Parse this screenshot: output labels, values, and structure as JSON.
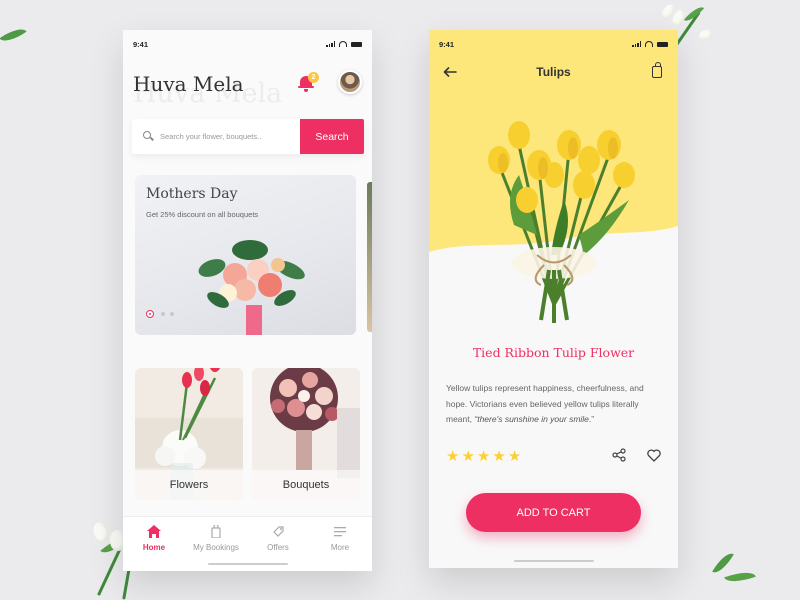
{
  "colors": {
    "accent": "#ee2f63",
    "yellow": "#fde67a",
    "star": "#fbd033",
    "badge": "#ffc53d"
  },
  "left_screen": {
    "status_time": "9:41",
    "brand_title": "Huva Mela",
    "brand_watermark": "Huva Mela",
    "notification_count": "2",
    "search": {
      "placeholder": "Search your flower, bouquets..",
      "button_label": "Search"
    },
    "banner": {
      "title": "Mothers Day",
      "subtitle": "Get 25% discount on all bouquets",
      "page_count": 3,
      "active_page": 1
    },
    "categories": [
      {
        "label": "Flowers"
      },
      {
        "label": "Bouquets"
      }
    ],
    "tabs": [
      {
        "label": "Home",
        "icon": "home-icon",
        "active": true
      },
      {
        "label": "My Bookings",
        "icon": "bag-icon",
        "active": false
      },
      {
        "label": "Offers",
        "icon": "tag-icon",
        "active": false
      },
      {
        "label": "More",
        "icon": "menu-icon",
        "active": false
      }
    ]
  },
  "right_screen": {
    "status_time": "9:41",
    "nav_title": "Tulips",
    "product": {
      "name": "Tied Ribbon Tulip Flower",
      "description_main": "Yellow tulips represent happiness, cheerfulness, and hope. Victorians even believed yellow tulips literally meant,",
      "description_quote": "“there's sunshine in your smile",
      "description_end": ".”",
      "rating": 5,
      "rating_max": 5
    },
    "cart_button_label": "ADD TO CART"
  }
}
